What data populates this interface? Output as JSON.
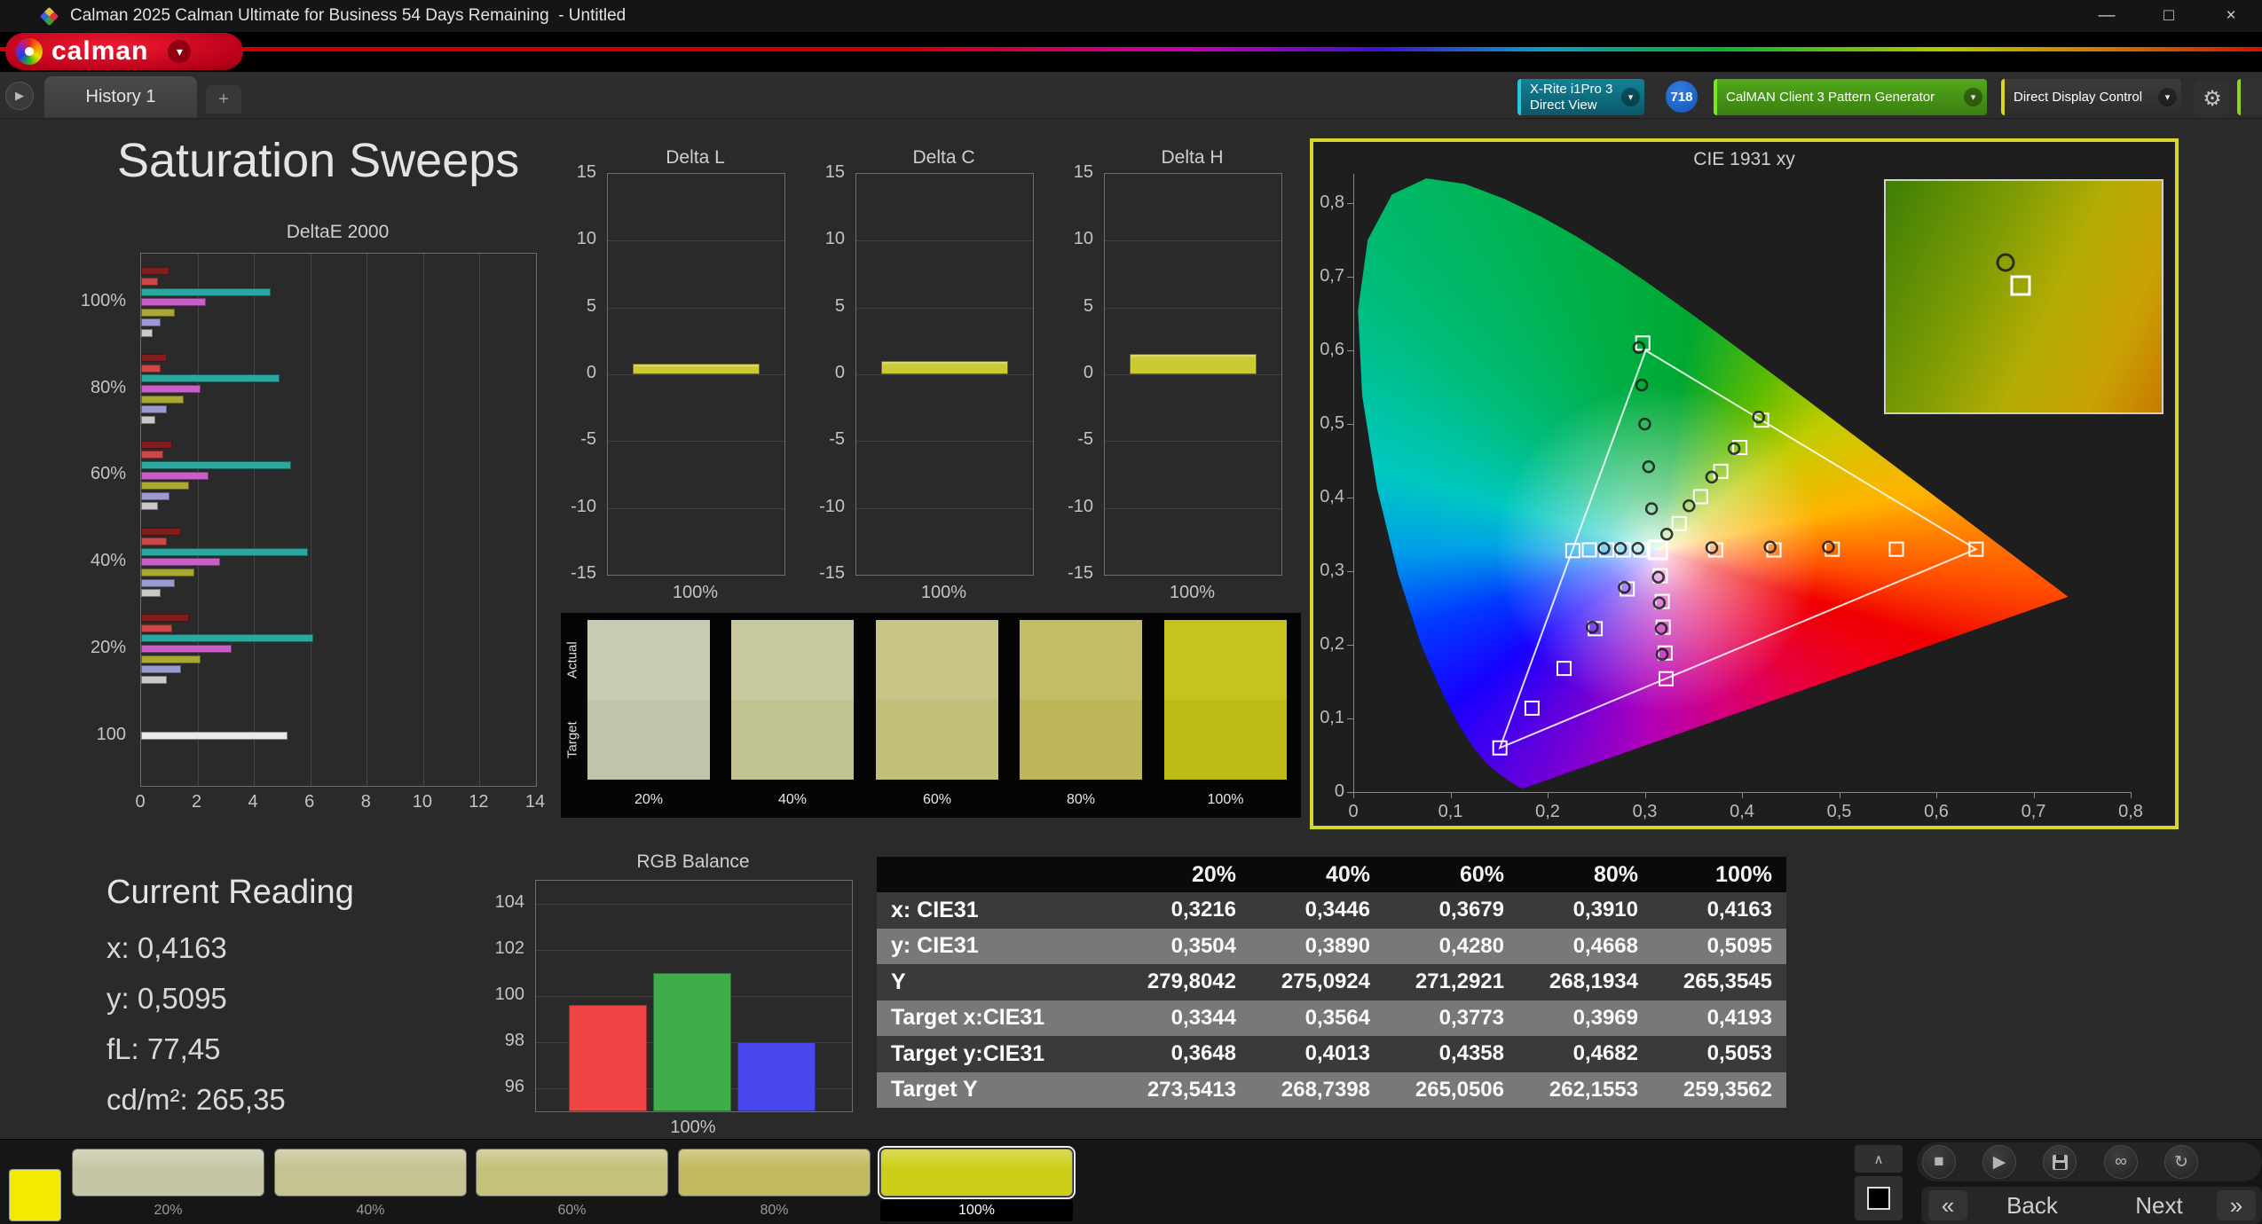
{
  "window": {
    "title": "Calman 2025 Calman Ultimate for Business 54 Days Remaining  - Untitled"
  },
  "icons": {
    "minimize": "—",
    "maximize": "□",
    "close": "×",
    "dropdown": "▾",
    "gear": "⚙",
    "plus": "+",
    "tab_nav": "▶",
    "stop": "■",
    "play": "▶",
    "link": "∞",
    "refresh": "↻",
    "chevron_up": "∧",
    "back_chevrons": "«",
    "next_chevrons": "»"
  },
  "logo": {
    "text": "calman"
  },
  "toolbar": {
    "meter": {
      "line1": "X-Rite i1Pro 3",
      "line2": "Direct View"
    },
    "badge": "718",
    "pattern": "CalMAN Client 3 Pattern Generator",
    "display": "Direct Display Control"
  },
  "tabs": {
    "active": "History 1"
  },
  "page_title": "Saturation Sweeps",
  "charts": {
    "deltae": {
      "type": "bar",
      "title": "DeltaE 2000",
      "xlim": [
        0,
        14
      ],
      "xticks": [
        0,
        2,
        4,
        6,
        8,
        10,
        12,
        14
      ],
      "series_colors": [
        "#7e1e1e",
        "#cf4848",
        "#2aa79e",
        "#c85fc8",
        "#a8a832",
        "#9a9ad0",
        "#c9c9c9"
      ],
      "groups": [
        {
          "label": "100%",
          "values": [
            1.0,
            0.6,
            4.6,
            2.3,
            1.2,
            0.7,
            0.4
          ]
        },
        {
          "label": "80%",
          "values": [
            0.9,
            0.7,
            4.9,
            2.1,
            1.5,
            0.9,
            0.5
          ]
        },
        {
          "label": "60%",
          "values": [
            1.1,
            0.8,
            5.3,
            2.4,
            1.7,
            1.0,
            0.6
          ]
        },
        {
          "label": "40%",
          "values": [
            1.4,
            0.9,
            5.9,
            2.8,
            1.9,
            1.2,
            0.7
          ]
        },
        {
          "label": "20%",
          "values": [
            1.7,
            1.1,
            6.1,
            3.2,
            2.1,
            1.4,
            0.9
          ]
        },
        {
          "label": "100",
          "values": [
            5.2
          ],
          "colors": [
            "#e8e8e8"
          ]
        }
      ]
    },
    "delta_bars": [
      {
        "type": "bar",
        "title": "Delta L",
        "value": 0.8,
        "xlabel": "100%",
        "ylim": [
          -15,
          15
        ],
        "yticks": [
          15,
          10,
          5,
          0,
          -5,
          -10,
          -15
        ],
        "color": "#c9c932"
      },
      {
        "type": "bar",
        "title": "Delta C",
        "value": 1.0,
        "xlabel": "100%",
        "ylim": [
          -15,
          15
        ],
        "yticks": [
          15,
          10,
          5,
          0,
          -5,
          -10,
          -15
        ],
        "color": "#c9c932"
      },
      {
        "type": "bar",
        "title": "Delta H",
        "value": 1.5,
        "xlabel": "100%",
        "ylim": [
          -15,
          15
        ],
        "yticks": [
          15,
          10,
          5,
          0,
          -5,
          -10,
          -15
        ],
        "color": "#c9c932"
      }
    ],
    "rgb": {
      "type": "bar",
      "title": "RGB Balance",
      "xlabel": "100%",
      "ylim": [
        95,
        105
      ],
      "yticks": [
        104,
        102,
        100,
        98,
        96
      ],
      "bars": [
        {
          "name": "red",
          "value": 99.6,
          "color": "#ef4545"
        },
        {
          "name": "green",
          "value": 101.0,
          "color": "#3fae4a"
        },
        {
          "name": "blue",
          "value": 98.0,
          "color": "#4747ec"
        }
      ]
    },
    "cie": {
      "type": "scatter",
      "title": "CIE 1931 xy",
      "xticks": [
        "0",
        "0,1",
        "0,2",
        "0,3",
        "0,4",
        "0,5",
        "0,6",
        "0,7",
        "0,8"
      ],
      "yticks": [
        "0,8",
        "0,7",
        "0,6",
        "0,5",
        "0,4",
        "0,3",
        "0,2",
        "0,1",
        "0"
      ],
      "locus": [
        [
          0.1741,
          0.005
        ],
        [
          0.169,
          0.007
        ],
        [
          0.1611,
          0.0138
        ],
        [
          0.151,
          0.0227
        ],
        [
          0.1355,
          0.0399
        ],
        [
          0.1241,
          0.0578
        ],
        [
          0.1096,
          0.0868
        ],
        [
          0.0913,
          0.1327
        ],
        [
          0.0687,
          0.2007
        ],
        [
          0.0454,
          0.295
        ],
        [
          0.0235,
          0.4127
        ],
        [
          0.0082,
          0.5384
        ],
        [
          0.0039,
          0.6548
        ],
        [
          0.0139,
          0.7502
        ],
        [
          0.0389,
          0.812
        ],
        [
          0.0743,
          0.8338
        ],
        [
          0.1142,
          0.8262
        ],
        [
          0.1547,
          0.8059
        ],
        [
          0.1929,
          0.7816
        ],
        [
          0.2296,
          0.7543
        ],
        [
          0.2658,
          0.7243
        ],
        [
          0.3016,
          0.6923
        ],
        [
          0.3373,
          0.6589
        ],
        [
          0.3731,
          0.6245
        ],
        [
          0.4441,
          0.5547
        ],
        [
          0.5125,
          0.4866
        ],
        [
          0.5752,
          0.4242
        ],
        [
          0.627,
          0.3725
        ],
        [
          0.6658,
          0.334
        ],
        [
          0.6915,
          0.3083
        ],
        [
          0.7079,
          0.292
        ],
        [
          0.719,
          0.2809
        ],
        [
          0.7283,
          0.2717
        ],
        [
          0.7347,
          0.2653
        ]
      ],
      "gamut_triangle": [
        [
          0.3,
          0.6
        ],
        [
          0.64,
          0.33
        ],
        [
          0.15,
          0.06
        ]
      ],
      "white_point": [
        0.3127,
        0.329
      ],
      "target_squares": [
        [
          0.3344,
          0.3648
        ],
        [
          0.3564,
          0.4013
        ],
        [
          0.3773,
          0.4358
        ],
        [
          0.3969,
          0.4682
        ],
        [
          0.4193,
          0.5053
        ],
        [
          0.372,
          0.329
        ],
        [
          0.432,
          0.329
        ],
        [
          0.492,
          0.33
        ],
        [
          0.558,
          0.33
        ],
        [
          0.64,
          0.33
        ],
        [
          0.297,
          0.61
        ],
        [
          0.295,
          0.329
        ],
        [
          0.277,
          0.329
        ],
        [
          0.26,
          0.329
        ],
        [
          0.242,
          0.329
        ],
        [
          0.225,
          0.328
        ],
        [
          0.281,
          0.276
        ],
        [
          0.248,
          0.222
        ],
        [
          0.216,
          0.168
        ],
        [
          0.183,
          0.114
        ],
        [
          0.15,
          0.06
        ],
        [
          0.315,
          0.294
        ],
        [
          0.317,
          0.259
        ],
        [
          0.318,
          0.224
        ],
        [
          0.32,
          0.189
        ],
        [
          0.321,
          0.154
        ]
      ],
      "measured_circles": [
        [
          0.3216,
          0.3504
        ],
        [
          0.3446,
          0.389
        ],
        [
          0.3679,
          0.428
        ],
        [
          0.391,
          0.4668
        ],
        [
          0.4163,
          0.5095
        ],
        [
          0.306,
          0.385
        ],
        [
          0.303,
          0.442
        ],
        [
          0.299,
          0.5
        ],
        [
          0.296,
          0.553
        ],
        [
          0.293,
          0.604
        ],
        [
          0.368,
          0.332
        ],
        [
          0.428,
          0.333
        ],
        [
          0.488,
          0.333
        ],
        [
          0.313,
          0.292
        ],
        [
          0.314,
          0.257
        ],
        [
          0.316,
          0.222
        ],
        [
          0.317,
          0.187
        ],
        [
          0.292,
          0.331
        ],
        [
          0.274,
          0.331
        ],
        [
          0.257,
          0.331
        ],
        [
          0.278,
          0.278
        ],
        [
          0.245,
          0.224
        ]
      ]
    }
  },
  "patch_panel": {
    "actual_label": "Actual",
    "target_label": "Target",
    "items": [
      {
        "label": "20%",
        "actual": "#c9cbb5",
        "target": "#c3c5ab"
      },
      {
        "label": "40%",
        "actual": "#c8c99e",
        "target": "#c2c392"
      },
      {
        "label": "60%",
        "actual": "#c7c586",
        "target": "#c1bf7a"
      },
      {
        "label": "80%",
        "actual": "#c3bd66",
        "target": "#bdb75a"
      },
      {
        "label": "100%",
        "actual": "#c6c21e",
        "target": "#bfbb15"
      }
    ]
  },
  "current_reading": {
    "title": "Current Reading",
    "lines": [
      "x: 0,4163",
      "y: 0,5095",
      "fL: 77,45",
      "cd/m²: 265,35"
    ]
  },
  "table": {
    "headers": [
      "20%",
      "40%",
      "60%",
      "80%",
      "100%"
    ],
    "rows": [
      {
        "label": "x: CIE31",
        "values": [
          "0,3216",
          "0,3446",
          "0,3679",
          "0,3910",
          "0,4163"
        ]
      },
      {
        "label": "y: CIE31",
        "values": [
          "0,3504",
          "0,3890",
          "0,4280",
          "0,4668",
          "0,5095"
        ]
      },
      {
        "label": "Y",
        "values": [
          "279,8042",
          "275,0924",
          "271,2921",
          "268,1934",
          "265,3545"
        ]
      },
      {
        "label": "Target x:CIE31",
        "values": [
          "0,3344",
          "0,3564",
          "0,3773",
          "0,3969",
          "0,4193"
        ]
      },
      {
        "label": "Target y:CIE31",
        "values": [
          "0,3648",
          "0,4013",
          "0,4358",
          "0,4682",
          "0,5053"
        ]
      },
      {
        "label": "Target Y",
        "values": [
          "273,5413",
          "268,7398",
          "265,0506",
          "262,1553",
          "259,3562"
        ]
      }
    ]
  },
  "bottom_bar": {
    "current_patch_color": "#f2ea00",
    "patches": [
      {
        "label": "20%",
        "color": "#c6c6a6",
        "active": false
      },
      {
        "label": "40%",
        "color": "#c6c392",
        "active": false
      },
      {
        "label": "60%",
        "color": "#c5c07c",
        "active": false
      },
      {
        "label": "80%",
        "color": "#c2ba5e",
        "active": false
      },
      {
        "label": "100%",
        "color": "#ccce17",
        "active": true
      }
    ],
    "back": "Back",
    "next": "Next"
  }
}
